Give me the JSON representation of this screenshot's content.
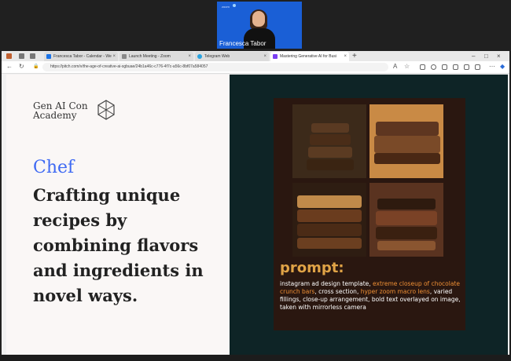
{
  "video": {
    "participant_name": "Francesca Tabor",
    "logo": "zoom"
  },
  "tabs": [
    {
      "label": "Francesca Tabor - Calendar - We",
      "icon": "calendar-icon",
      "color": "#1a73e8"
    },
    {
      "label": "Launch Meeting - Zoom",
      "icon": "page-icon",
      "color": "#888888"
    },
    {
      "label": "Telegram Web",
      "icon": "telegram-icon",
      "color": "#29a3e0"
    },
    {
      "label": "Mastering Generative AI for Busi",
      "icon": "pitch-icon",
      "color": "#7b3ff2"
    }
  ],
  "address": {
    "url": "https://pitch.com/v/the-age-of-creative-ai-sgbuae/24b1a46c-c776-4f7c-a56c-8bf07a584057"
  },
  "slide": {
    "brand_line1": "Gen AI Con",
    "brand_line2": "Academy",
    "role": "Chef",
    "description": "Crafting unique recipes by combining flavors and ingredients in novel ways.",
    "prompt_title": "prompt:",
    "prompt_parts": [
      {
        "text": "instagram ad design template, ",
        "highlight": false
      },
      {
        "text": "extreme closeup of chocolate crunch bars",
        "highlight": true
      },
      {
        "text": ", cross section, ",
        "highlight": false
      },
      {
        "text": "hyper zoom macro lens",
        "highlight": true
      },
      {
        "text": ", varied fillings, close-up arrangement, bold text overlayed on image, taken with mirrorless camera",
        "highlight": false
      }
    ]
  },
  "colors": {
    "accent": "#3f6af3",
    "prompt": "#e0a346",
    "highlight": "#ee8f35",
    "slide_right_bg": "#0e2426"
  }
}
